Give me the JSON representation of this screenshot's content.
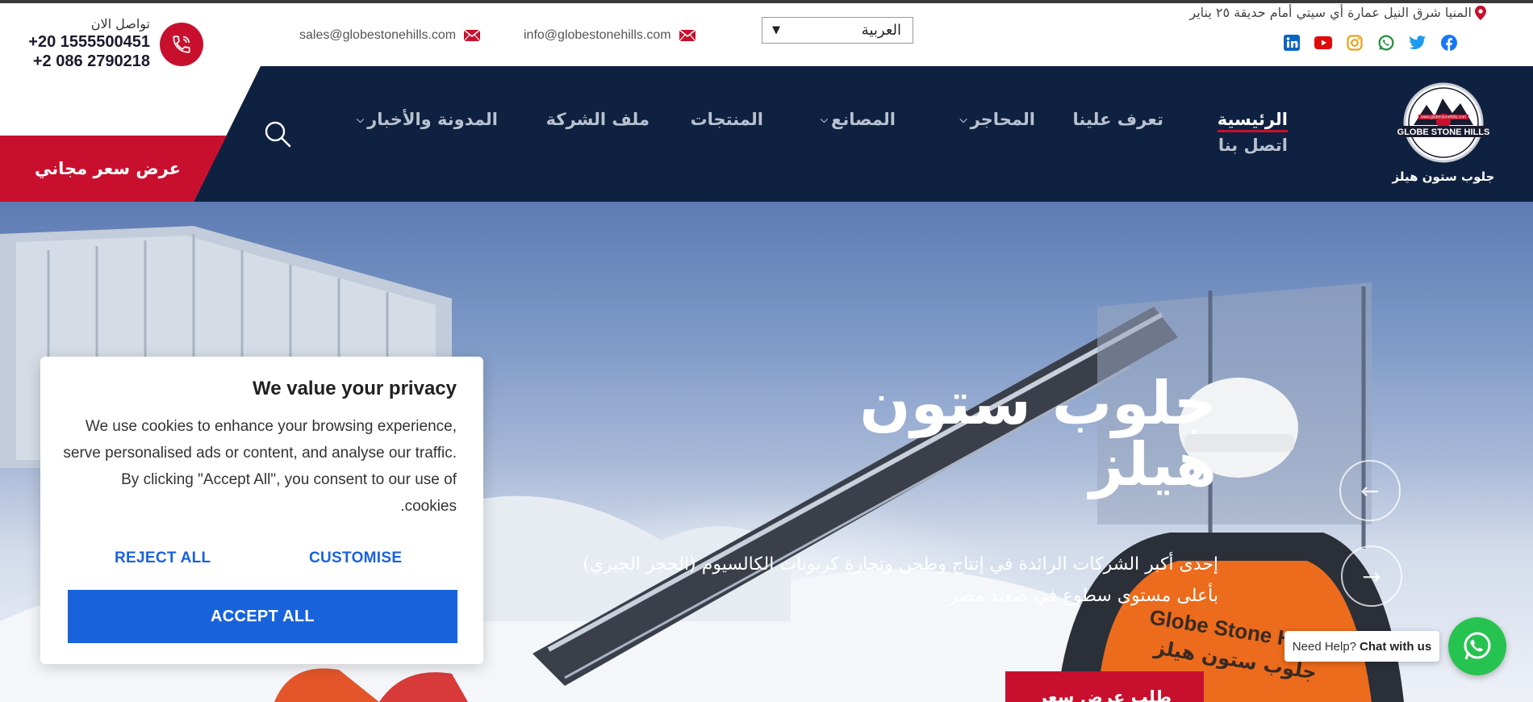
{
  "topbar": {
    "contact_label": "تواصل الان",
    "phone_1": "+20 1555500451",
    "phone_2": "+2 086 2790218",
    "email_sales": "sales@globestonehills.com",
    "email_info": "info@globestonehills.com",
    "language_selected": "العربية",
    "address": "المنيا شرق النيل عمارة أي سيتي أمام حديقة ٢٥ يناير",
    "social_icons": [
      "facebook-icon",
      "twitter-icon",
      "whatsapp-icon",
      "instagram-icon",
      "youtube-icon",
      "linkedin-icon"
    ]
  },
  "header": {
    "quote_button": "عرض سعر مجاني",
    "nav": {
      "home": "الرئيسية",
      "about": "تعرف علينا",
      "quarries": "المحاجر",
      "factories": "المصانع",
      "products": "المنتجات",
      "company_profile": "ملف الشركة",
      "blog_news": "المدونة والأخبار",
      "contact": "اتصل بنا"
    },
    "logo": {
      "name_en": "GLOBE STONE HILLS",
      "name_ar": "جلوب ستون هيلز",
      "url": "www.globestonehills.com"
    }
  },
  "hero": {
    "title": "جلوب ستون هيلز",
    "subtitle": "إحدى أكبر الشركات الرائدة في إنتاج وطحن وتجارة كربونات الكالسيوم (الحجر الجيري) بأعلى مستوى سطوع في صعيد مصر.",
    "cta": "طلب عرض سعر",
    "vest_text_en": "Globe Stone Hills",
    "vest_text_ar": "جلوب ستون هيلز"
  },
  "whatsapp": {
    "prompt": "Need Help?",
    "action": "Chat with us"
  },
  "cookie_banner": {
    "title": "We value your privacy",
    "body": "We use cookies to enhance your browsing experience, serve personalised ads or content, and analyse our traffic. By clicking \"Accept All\", you consent to our use of cookies.",
    "reject": "REJECT ALL",
    "customise": "CUSTOMISE",
    "accept": "ACCEPT ALL"
  },
  "colors": {
    "brand_red": "#c8102e",
    "navy": "#0f2140",
    "cookie_blue": "#1863dc",
    "whatsapp_green": "#27c351"
  }
}
